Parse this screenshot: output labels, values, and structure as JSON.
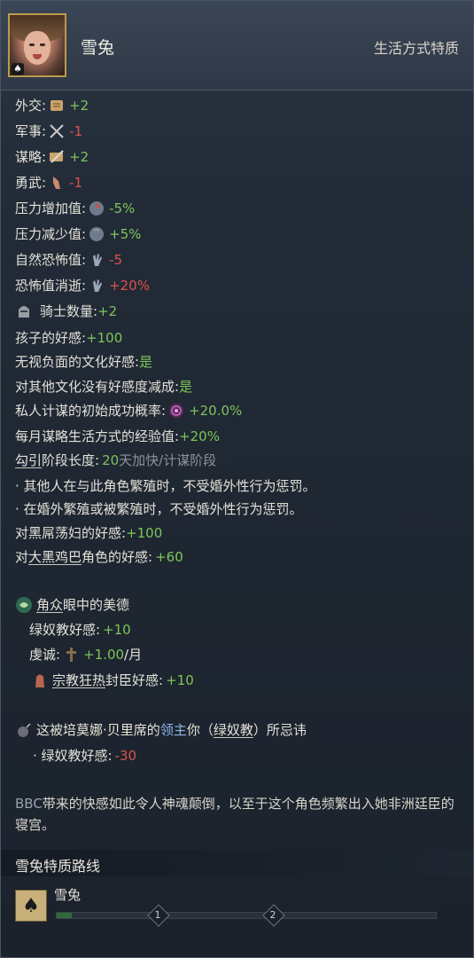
{
  "trait": {
    "name": "雪兔",
    "category": "生活方式特质"
  },
  "stats": [
    {
      "label": "外交:",
      "value": "+2",
      "icon": "scroll-icon"
    },
    {
      "label": "军事:",
      "value": "-1",
      "icon": "crossed-swords-icon"
    },
    {
      "label": "谋略:",
      "value": "+2",
      "icon": "dagger-icon"
    },
    {
      "label": "勇武:",
      "value": "-1",
      "icon": "fist-icon"
    },
    {
      "label": "压力增加值:",
      "value": "-5%",
      "icon": "stress-head-icon"
    },
    {
      "label": "压力减少值:",
      "value": "+5%",
      "icon": "stress-head-icon"
    },
    {
      "label": "自然恐怖值:",
      "value": "-5",
      "icon": "dread-hand-icon"
    },
    {
      "label": "恐怖值消逝:",
      "value": "+20%",
      "icon": "dread-hand-icon"
    },
    {
      "label": "骑士数量:",
      "value": "+2",
      "icon": "knight-helmet-icon"
    },
    {
      "label": "孩子的好感:",
      "value": "+100"
    },
    {
      "label": "无视负面的文化好感:",
      "value": "是"
    },
    {
      "label": "对其他文化没有好感度减成:",
      "value": "是"
    },
    {
      "label": "私人计谋的初始成功概率:",
      "value": "+20.0%",
      "icon": "scheme-target-icon"
    },
    {
      "label": "每月谋略生活方式的经验值:",
      "value": "+20%"
    }
  ],
  "seduce_phase": {
    "link": "勾引",
    "label": "阶段长度:",
    "value": "20",
    "suffix": "天加快/计谋阶段"
  },
  "bullets": [
    "· 其他人在与此角色繁殖时，不受婚外性行为惩罚。",
    "· 在婚外繁殖或被繁殖时，不受婚外性行为惩罚。"
  ],
  "opinion_blacked": {
    "label": "对黑屌荡妇的好感:",
    "value": "+100"
  },
  "opinion_bbc": {
    "prefix": "对",
    "link": "大黑鸡巴",
    "suffix": "角色的好感:",
    "value": "+60"
  },
  "virtue": {
    "title_link": "角众",
    "title_rest": "眼中的美德",
    "opinion": {
      "label": "绿奴教好感:",
      "value": "+10"
    },
    "piety": {
      "label": "虔诚:",
      "value": "+1.00",
      "unit": "/月"
    },
    "zealot": {
      "link": "宗教狂热",
      "rest": "封臣好感:",
      "value": "+10"
    }
  },
  "shunned": {
    "prefix": "这被",
    "person": "培莫娜·贝里席",
    "mid": "的",
    "liege": "领主",
    "you": "你",
    "paren_open": "（",
    "faith": "绿奴教",
    "paren_close": "）",
    "suffix": "所忌讳",
    "opinion": {
      "label": "· 绿奴教好感:",
      "value": "-30"
    }
  },
  "description": {
    "lead": "BBC",
    "text": "带来的快感如此令人神魂颠倒，以至于这个角色频繁出入她非洲廷臣的寝宫。"
  },
  "track": {
    "title": "雪兔特质路线",
    "name": "雪兔",
    "progress": 0.04,
    "markers": [
      "1",
      "2"
    ]
  },
  "colors": {
    "positive": "#7cc65a",
    "negative": "#e0524a",
    "accent": "#c7b07a"
  }
}
